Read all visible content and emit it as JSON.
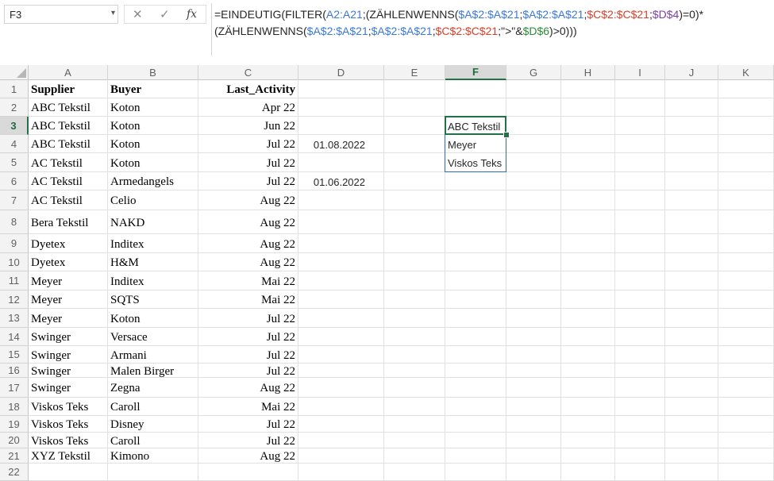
{
  "name_box": "F3",
  "formula_bar": {
    "segments": [
      {
        "text": "=EINDEUTIG(FILTER(",
        "color": "#262626"
      },
      {
        "text": "A2:A21",
        "color": "#3c78d8"
      },
      {
        "text": ";(ZÄHLENWENNS(",
        "color": "#262626"
      },
      {
        "text": "$A$2:$A$21",
        "color": "#3c78d8"
      },
      {
        "text": ";",
        "color": "#262626"
      },
      {
        "text": "$A$2:$A$21",
        "color": "#3c78d8"
      },
      {
        "text": ";",
        "color": "#262626"
      },
      {
        "text": "$C$2:$C$21",
        "color": "#d9402b"
      },
      {
        "text": ";",
        "color": "#262626"
      },
      {
        "text": "$D$4",
        "color": "#7b3fa0"
      },
      {
        "text": ")=0)*",
        "color": "#262626"
      },
      {
        "br": true
      },
      {
        "text": "(ZÄHLENWENNS(",
        "color": "#262626"
      },
      {
        "text": "$A$2:$A$21",
        "color": "#3c78d8"
      },
      {
        "text": ";",
        "color": "#262626"
      },
      {
        "text": "$A$2:$A$21",
        "color": "#3c78d8"
      },
      {
        "text": ";",
        "color": "#262626"
      },
      {
        "text": "$C$2:$C$21",
        "color": "#d9402b"
      },
      {
        "text": ";\">\"&",
        "color": "#262626"
      },
      {
        "text": "$D$6",
        "color": "#2e8b3a"
      },
      {
        "text": ")>0)))",
        "color": "#262626"
      }
    ]
  },
  "columns": [
    "A",
    "B",
    "C",
    "D",
    "E",
    "F",
    "G",
    "H",
    "I",
    "J",
    "K"
  ],
  "selected_column": "F",
  "selected_row": 3,
  "rows": [
    {
      "n": "1",
      "A": "Supplier",
      "B": "Buyer",
      "C": "Last_Activity",
      "D": "",
      "F": ""
    },
    {
      "n": "2",
      "A": "ABC Tekstil",
      "B": "Koton",
      "C": "Apr 22",
      "D": "",
      "F": ""
    },
    {
      "n": "3",
      "A": "ABC Tekstil",
      "B": "Koton",
      "C": "Jun 22",
      "D": "",
      "F": "ABC Tekstil"
    },
    {
      "n": "4",
      "A": "ABC Tekstil",
      "B": "Koton",
      "C": "Jul 22",
      "D": "01.08.2022",
      "F": "Meyer"
    },
    {
      "n": "5",
      "A": "AC Tekstil",
      "B": "Koton",
      "C": "Jul 22",
      "D": "",
      "F": "Viskos Teks"
    },
    {
      "n": "6",
      "A": "AC Tekstil",
      "B": "Armedangels",
      "C": "Jul 22",
      "D": "01.06.2022",
      "F": ""
    },
    {
      "n": "7",
      "A": "AC Tekstil",
      "B": "Celio",
      "C": "Aug 22",
      "D": "",
      "F": ""
    },
    {
      "n": "8",
      "A": "Bera Tekstil",
      "B": "NAKD",
      "C": "Aug 22",
      "D": "",
      "F": ""
    },
    {
      "n": "9",
      "A": "Dyetex",
      "B": "Inditex",
      "C": "Aug 22",
      "D": "",
      "F": ""
    },
    {
      "n": "10",
      "A": "Dyetex",
      "B": "H&M",
      "C": "Aug 22",
      "D": "",
      "F": ""
    },
    {
      "n": "11",
      "A": "Meyer",
      "B": "Inditex",
      "C": "Mai 22",
      "D": "",
      "F": ""
    },
    {
      "n": "12",
      "A": "Meyer",
      "B": "SQTS",
      "C": "Mai 22",
      "D": "",
      "F": ""
    },
    {
      "n": "13",
      "A": "Meyer",
      "B": "Koton",
      "C": "Jul 22",
      "D": "",
      "F": ""
    },
    {
      "n": "14",
      "A": "Swinger",
      "B": "Versace",
      "C": "Jul 22",
      "D": "",
      "F": ""
    },
    {
      "n": "15",
      "A": "Swinger",
      "B": "Armani",
      "C": "Jul 22",
      "D": "",
      "F": ""
    },
    {
      "n": "16",
      "A": "Swinger",
      "B": "Malen Birger",
      "C": "Jul 22",
      "D": "",
      "F": ""
    },
    {
      "n": "17",
      "A": "Swinger",
      "B": "Zegna",
      "C": "Aug 22",
      "D": "",
      "F": ""
    },
    {
      "n": "18",
      "A": "Viskos Teks",
      "B": "Caroll",
      "C": "Mai 22",
      "D": "",
      "F": ""
    },
    {
      "n": "19",
      "A": "Viskos Teks",
      "B": "Disney",
      "C": "Jul 22",
      "D": "",
      "F": ""
    },
    {
      "n": "20",
      "A": "Viskos Teks",
      "B": "Caroll",
      "C": "Jul 22",
      "D": "",
      "F": ""
    },
    {
      "n": "21",
      "A": "XYZ Tekstil",
      "B": "Kimono",
      "C": "Aug 22",
      "D": "",
      "F": ""
    },
    {
      "n": "22",
      "A": "",
      "B": "",
      "C": "",
      "D": "",
      "F": ""
    }
  ]
}
